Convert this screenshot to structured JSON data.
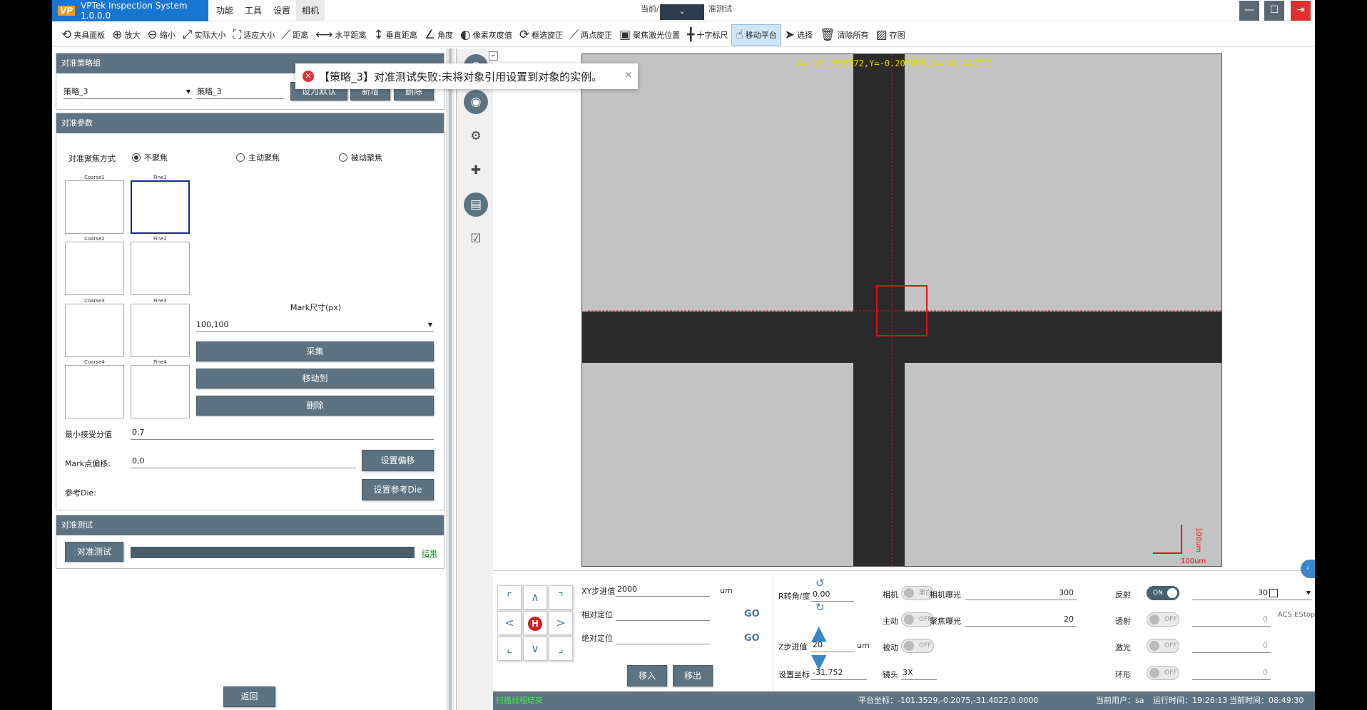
{
  "window": {
    "app_title": "VPTek Inspection System 1.0.0.0",
    "logo": "VP",
    "title_left": "当前/",
    "title_right": "准测试",
    "camera_select": ""
  },
  "menu": [
    "功能",
    "工具",
    "设置",
    "相机"
  ],
  "toolbar": [
    "夹具面板",
    "放大",
    "缩小",
    "实际大小",
    "适应大小",
    "距离",
    "水平距离",
    "垂直距离",
    "角度",
    "像素灰度值",
    "框选旋正",
    "两点旋正",
    "聚焦激光位置",
    "十字标尺",
    "移动平台",
    "选择",
    "清除所有",
    "存图"
  ],
  "strategy": {
    "header": "对准策略组",
    "select_value": "策略_3",
    "name_value": "策略_3",
    "set_default": "设为默认",
    "add": "新增",
    "delete": "删除"
  },
  "toast": {
    "message": "【策略_3】对准测试失败:未将对象引用设置到对象的实例。",
    "close": "×"
  },
  "params": {
    "header": "对准参数",
    "focus_label": "对准聚焦方式",
    "radio_none": "不聚焦",
    "radio_active": "主动聚焦",
    "radio_passive": "被动聚焦",
    "thumbs": [
      "Coarse1",
      "Fine1",
      "Coarse2",
      "Fine2",
      "Coarse3",
      "Fine3",
      "Coarse4",
      "Fine4"
    ],
    "mark_size_label": "Mark尺寸(px)",
    "mark_size_value": "100,100",
    "collect": "采集",
    "move_to": "移动到",
    "delete": "删除",
    "min_score_label": "最小接受分值",
    "min_score_value": "0.7",
    "mark_offset_label": "Mark点偏移:",
    "mark_offset_value": "0,0",
    "set_offset": "设置偏移",
    "ref_die_label": "参考Die:",
    "set_ref_die": "设置参考Die"
  },
  "test": {
    "header": "对准测试",
    "button": "对准测试",
    "result": "结果"
  },
  "back": "返回",
  "image": {
    "coords": "X=-101.352372,Y=-0.207495,Z=-31.402212",
    "scale": "100um"
  },
  "controls": {
    "xy_step_label": "XY步进值",
    "xy_step_value": "2000",
    "xy_unit": "um",
    "rel_label": "相对定位",
    "abs_label": "绝对定位",
    "go": "GO",
    "move_in": "移入",
    "move_out": "移出",
    "r_label": "R转角/度",
    "r_value": "0.00",
    "z_step_label": "Z步进值",
    "z_step_value": "20",
    "z_unit": "um",
    "set_coord_label": "设置坐标",
    "set_coord_value": "-31.752",
    "camera_label": "相机",
    "camera_toggle": "黑白",
    "camera_exposure_label": "相机曝光",
    "camera_exposure_value": "300",
    "active_label": "主动",
    "active_toggle": "OFF",
    "focus_exposure_label": "聚焦曝光",
    "focus_exposure_value": "20",
    "passive_label": "被动",
    "passive_toggle": "OFF",
    "lens_label": "镜头",
    "lens_value": "3X",
    "reflect_label": "反射",
    "reflect_toggle": "ON",
    "reflect_value": "30",
    "transmit_label": "透射",
    "transmit_toggle": "OFF",
    "transmit_value": "0",
    "laser_label": "激光",
    "laser_toggle": "OFF",
    "laser_value": "0",
    "ring_label": "环形",
    "ring_toggle": "OFF",
    "ring_value": "0",
    "estop": "ACS.EStop"
  },
  "status": {
    "left": "扫描线程结束",
    "platform": "平台坐标：-101.3529,-0.2075,-31.4022,0.0000",
    "user": "当前用户：sa",
    "runtime": "运行时间：19:26:13",
    "clock": "当前时间：08:49:30"
  }
}
